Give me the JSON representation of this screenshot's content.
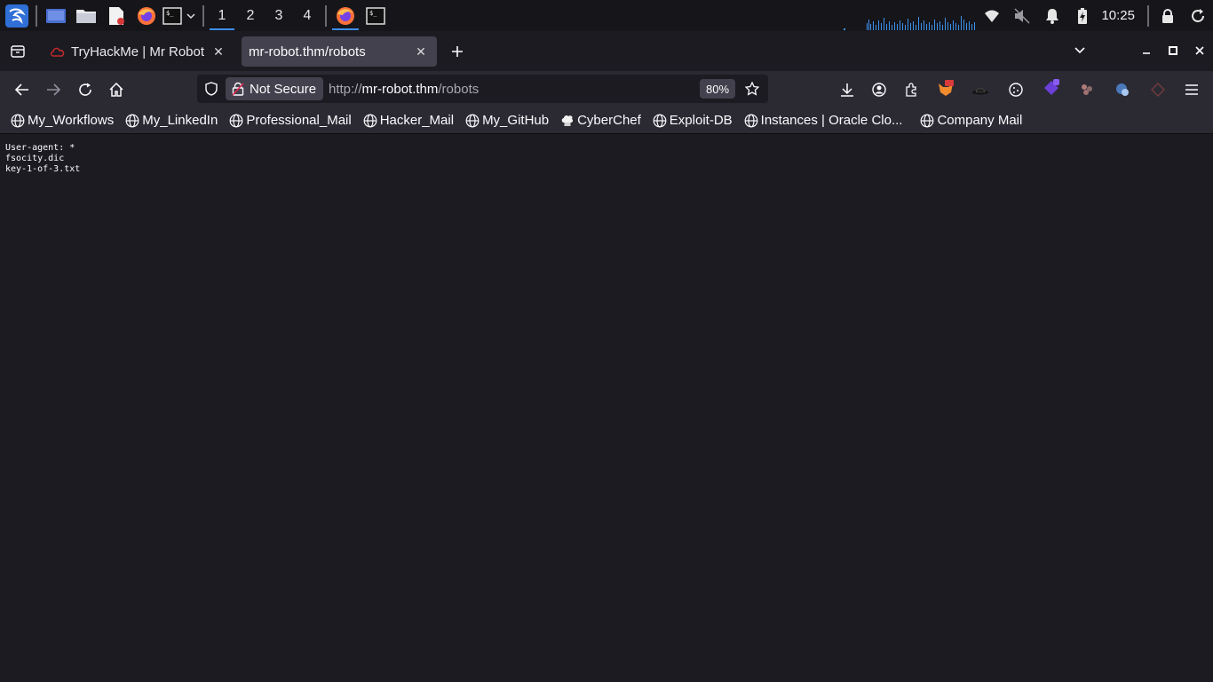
{
  "panel": {
    "workspaces": [
      "1",
      "2",
      "3",
      "4"
    ],
    "active_workspace": "1",
    "clock": "10:25",
    "accent": "#3d8fef"
  },
  "browser": {
    "tabs": [
      {
        "title": "TryHackMe | Mr Robot CTF",
        "icon": "tryhackme-icon"
      },
      {
        "title": "mr-robot.thm/robots",
        "active": true
      }
    ],
    "security_label": "Not Secure",
    "url": {
      "scheme": "http://",
      "host": "mr-robot.thm",
      "path": "/robots"
    },
    "zoom": "80%"
  },
  "bookmarks": [
    {
      "label": "My_Workflows",
      "icon": "globe-icon"
    },
    {
      "label": "My_LinkedIn",
      "icon": "globe-icon"
    },
    {
      "label": "Professional_Mail",
      "icon": "globe-icon"
    },
    {
      "label": "Hacker_Mail",
      "icon": "globe-icon"
    },
    {
      "label": "My_GitHub",
      "icon": "globe-icon"
    },
    {
      "label": "CyberChef",
      "icon": "chef-hat-icon"
    },
    {
      "label": "Exploit-DB",
      "icon": "globe-icon"
    },
    {
      "label": "Instances | Oracle Clo...",
      "icon": "globe-icon"
    },
    {
      "label": "Company Mail",
      "icon": "globe-icon"
    }
  ],
  "page": {
    "lines": [
      "User-agent: *",
      "fsocity.dic",
      "key-1-of-3.txt"
    ]
  }
}
